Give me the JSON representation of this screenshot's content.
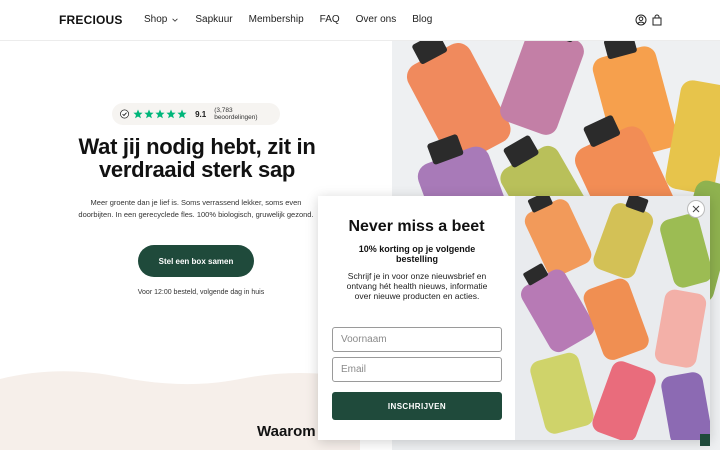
{
  "header": {
    "logo": "FRECIOUS",
    "nav": [
      {
        "label": "Shop",
        "has_dropdown": true
      },
      {
        "label": "Sapkuur"
      },
      {
        "label": "Membership"
      },
      {
        "label": "FAQ"
      },
      {
        "label": "Over ons"
      },
      {
        "label": "Blog"
      }
    ],
    "icons": [
      "user-icon",
      "cart-icon"
    ]
  },
  "hero": {
    "rating": {
      "score": "9.1",
      "count": "(3,783 beoordelingen)",
      "stars": 5
    },
    "headline": "Wat jij nodig hebt, zit in verdraaid sterk sap",
    "subtext": "Meer groente dan je lief is. Soms verrassend lekker, soms even doorbijten. In een gerecyclede fles. 100% biologisch, gruwelijk gezond.",
    "cta_label": "Stel een box samen",
    "delivery_note": "Voor 12:00 besteld, volgende dag in huis"
  },
  "section": {
    "title_partial": "Waarom d"
  },
  "popup": {
    "title": "Never miss a beet",
    "subtitle": "10% korting op je volgende bestelling",
    "body": "Schrijf je in voor onze nieuwsbrief en ontvang hét health nieuws, informatie over nieuwe producten en acties.",
    "first_name_placeholder": "Voornaam",
    "email_placeholder": "Email",
    "submit_label": "INSCHRIJVEN"
  },
  "colors": {
    "brand_green": "#1f4a3b",
    "star_green": "#00b67a",
    "wave": "#f6efea"
  }
}
